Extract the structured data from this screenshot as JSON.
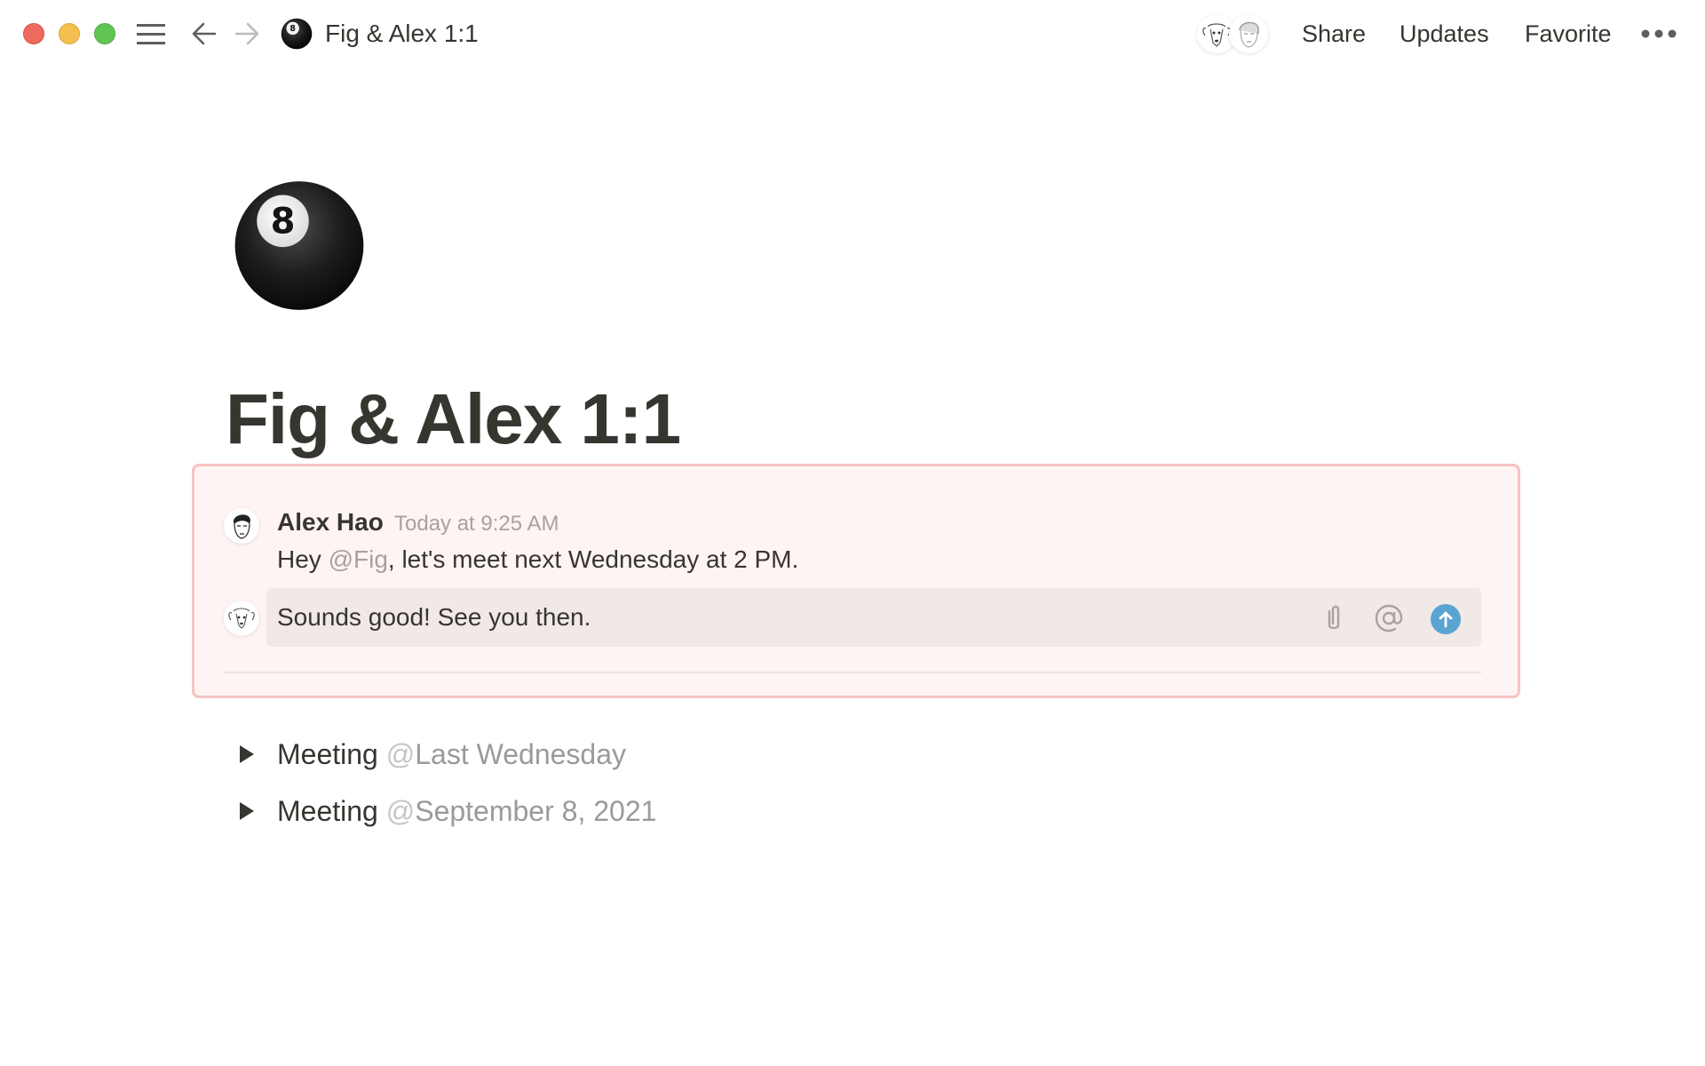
{
  "window": {
    "traffic_lights": [
      "close",
      "minimize",
      "zoom"
    ],
    "breadcrumb_icon": "8-ball-emoji",
    "breadcrumb_title": "Fig & Alex 1:1"
  },
  "topbar": {
    "avatars": [
      {
        "name": "Fig",
        "icon": "dog-avatar-icon"
      },
      {
        "name": "Alex Hao",
        "icon": "person-avatar-icon"
      }
    ],
    "share_label": "Share",
    "updates_label": "Updates",
    "favorite_label": "Favorite",
    "more_icon": "ellipsis-icon"
  },
  "page": {
    "icon": "8-ball-emoji",
    "title": "Fig & Alex 1:1"
  },
  "comment": {
    "author": "Alex Hao",
    "timestamp": "Today at 9:25 AM",
    "text_before": "Hey ",
    "mention": "@Fig",
    "text_after": ", let's meet next Wednesday at 2 PM.",
    "reply_value": "Sounds good! See you then.",
    "colors": {
      "border": "#f6c3c3",
      "background": "#fdf4f3",
      "send_button": "#5aa4d1"
    }
  },
  "toggles": [
    {
      "label": "Meeting",
      "at": "@",
      "date": "Last Wednesday"
    },
    {
      "label": "Meeting",
      "at": "@",
      "date": "September 8, 2021"
    }
  ]
}
